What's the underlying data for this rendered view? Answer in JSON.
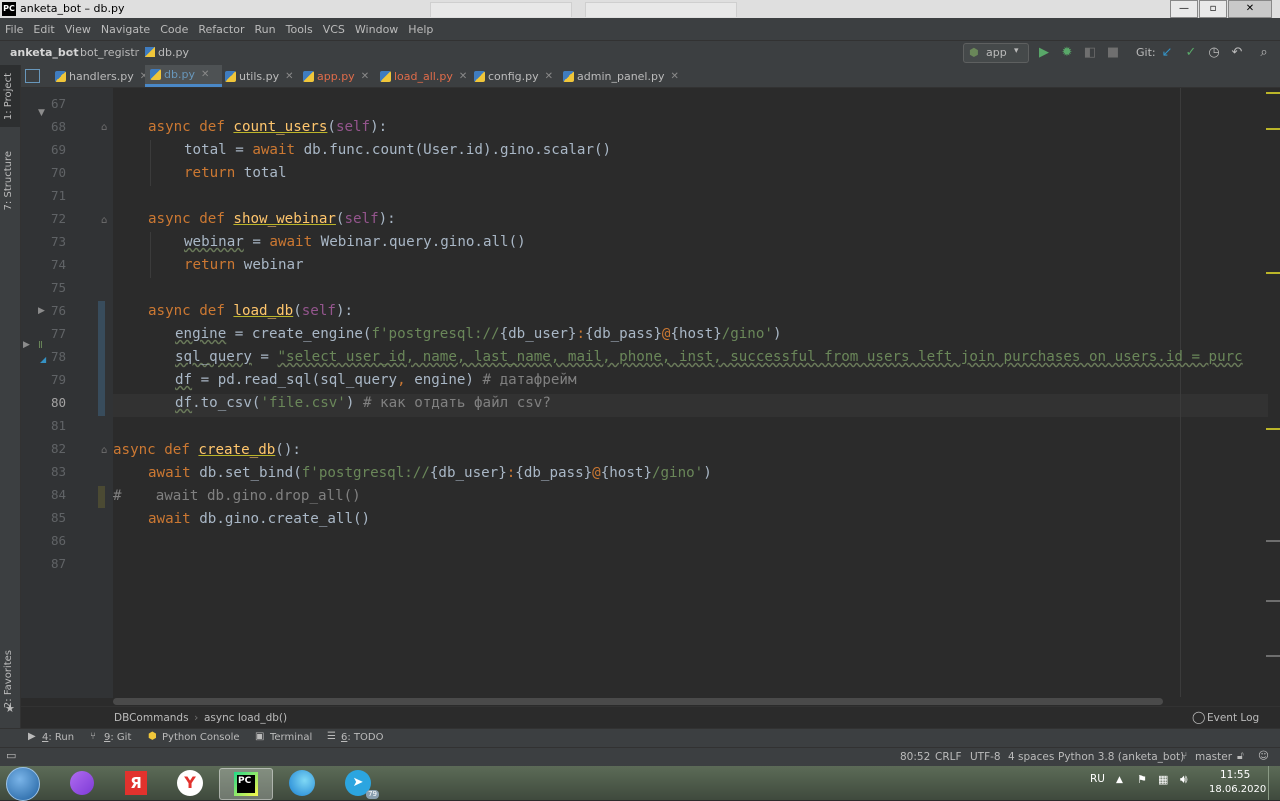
{
  "window": {
    "title": "anketa_bot – db.py",
    "logo_text": "PC"
  },
  "menu": [
    "File",
    "Edit",
    "View",
    "Navigate",
    "Code",
    "Refactor",
    "Run",
    "Tools",
    "VCS",
    "Window",
    "Help"
  ],
  "breadcrumb": [
    "anketa_bot",
    "bot_registr",
    "db.py"
  ],
  "run_config": "app",
  "git_label": "Git:",
  "tabs": [
    {
      "label": "handlers.py",
      "active": false,
      "color": "#bbbbbb"
    },
    {
      "label": "db.py",
      "active": true,
      "color": "#6897bb"
    },
    {
      "label": "utils.py",
      "active": false,
      "color": "#bbbbbb"
    },
    {
      "label": "app.py",
      "active": false,
      "color": "#e06c4a"
    },
    {
      "label": "load_all.py",
      "active": false,
      "color": "#e06c4a"
    },
    {
      "label": "config.py",
      "active": false,
      "color": "#bbbbbb"
    },
    {
      "label": "admin_panel.py",
      "active": false,
      "color": "#bbbbbb"
    }
  ],
  "left_tools": {
    "project": "1: Project",
    "structure": "7: Structure",
    "favorites": "2: Favorites"
  },
  "line_numbers": [
    "67",
    "68",
    "69",
    "70",
    "71",
    "72",
    "73",
    "74",
    "75",
    "76",
    "77",
    "78",
    "79",
    "80",
    "81",
    "82",
    "83",
    "84",
    "85",
    "86",
    "87"
  ],
  "current_line": "80",
  "code": {
    "l68": [
      "async def ",
      "count_users",
      "(",
      "self",
      "):"
    ],
    "l69": [
      "total = ",
      "await ",
      "db.func.count(User.id).gino.scalar()"
    ],
    "l70": [
      "return ",
      "total"
    ],
    "l72": [
      "async def ",
      "show_webinar",
      "(",
      "self",
      "):"
    ],
    "l73": [
      "webinar",
      " = ",
      "await ",
      "Webinar.query.gino.all()"
    ],
    "l74": [
      "return ",
      "webinar"
    ],
    "l76": [
      "async def ",
      "load_db",
      "(",
      "self",
      "):"
    ],
    "l77": [
      "engine",
      " = create_engine(",
      "f'postgresql://",
      "{db_user}",
      ":",
      "{db_pass}",
      "@",
      "{host}",
      "/gino'",
      ")"
    ],
    "l78": [
      "sql_query",
      " = ",
      "\"select user_id, name, last_name, mail, phone, inst, successful from users left join purchases on users.id = purc"
    ],
    "l79": [
      "df",
      " = pd.read_sql(sql_query",
      ", ",
      "engine)",
      " # датафрейм"
    ],
    "l80": [
      "df",
      ".to_csv(",
      "'file.csv'",
      ")",
      " # как отдать файл csv?"
    ],
    "l82": [
      "async def ",
      "create_db",
      "():"
    ],
    "l83": [
      "await ",
      "db.set_bind(",
      "f'postgresql://",
      "{db_user}",
      ":",
      "{db_pass}",
      "@",
      "{host}",
      "/gino'",
      ")"
    ],
    "l84": [
      "#    await db.gino.drop_all()"
    ],
    "l85": [
      "await ",
      "db.gino.create_all()"
    ]
  },
  "editor_breadcrumb": [
    "DBCommands",
    "async load_db()"
  ],
  "tool_buttons": [
    {
      "num": "4",
      "label": ": Run"
    },
    {
      "num": "9",
      "label": ": Git"
    },
    {
      "num": "",
      "label": "Python Console"
    },
    {
      "num": "",
      "label": "Terminal"
    },
    {
      "num": "6",
      "label": ": TODO"
    }
  ],
  "event_log": "Event Log",
  "status": {
    "position": "80:52",
    "line_sep": "CRLF",
    "encoding": "UTF-8",
    "indent": "4 spaces",
    "interpreter": "Python 3.8 (anketa_bot)",
    "branch": "master"
  },
  "taskbar": {
    "lang": "RU",
    "time": "11:55",
    "date": "18.06.2020",
    "telegram_badge": "79",
    "apps": [
      "start-orb",
      "alice",
      "yandex",
      "yandex-browser",
      "pycharm",
      "edge",
      "telegram"
    ]
  }
}
